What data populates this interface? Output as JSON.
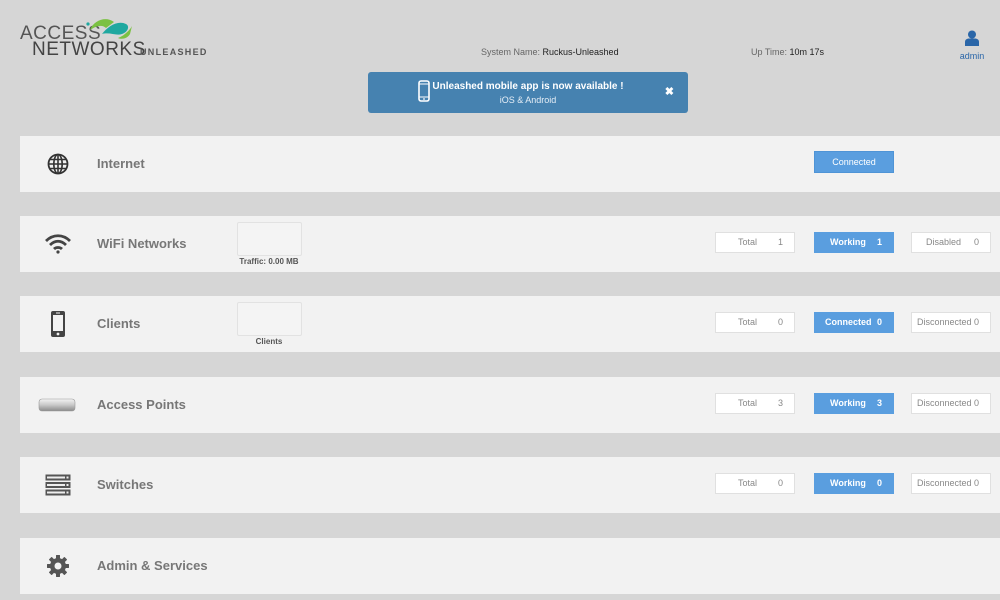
{
  "header": {
    "logo_line1": "ACCESS",
    "logo_line2": "NETWORKS",
    "logo_product": "UNLEASHED",
    "system_name_label": "System Name:",
    "system_name_value": "Ruckus-Unleashed",
    "uptime_label": "Up Time:",
    "uptime_value": "10m 17s",
    "user_label": "admin",
    "user_icon": "user-icon"
  },
  "banner": {
    "title": "Unleashed mobile app is now available !",
    "subtitle": "iOS & Android",
    "icon": "mobile-phone-icon",
    "close_icon": "close-icon",
    "color": "#4682b0"
  },
  "colors": {
    "accent": "#5a9edf",
    "row_bg": "#f2f2f2",
    "page_bg": "#d6d6d6"
  },
  "rows": {
    "internet": {
      "title": "Internet",
      "icon": "globe-icon",
      "status": "Connected"
    },
    "wifi": {
      "title": "WiFi Networks",
      "icon": "wifi-icon",
      "mini_label": "Traffic: 0.00 MB",
      "total_label": "Total",
      "total": "1",
      "working_label": "Working",
      "working": "1",
      "disabled_label": "Disabled",
      "disabled": "0"
    },
    "clients": {
      "title": "Clients",
      "icon": "smartphone-icon",
      "mini_label": "Clients",
      "total_label": "Total",
      "total": "0",
      "connected_label": "Connected",
      "connected": "0",
      "disconnected_label": "Disconnected",
      "disconnected": "0"
    },
    "access_points": {
      "title": "Access Points",
      "icon": "access-point-icon",
      "total_label": "Total",
      "total": "3",
      "working_label": "Working",
      "working": "3",
      "disconnected_label": "Disconnected",
      "disconnected": "0"
    },
    "switches": {
      "title": "Switches",
      "icon": "server-rack-icon",
      "total_label": "Total",
      "total": "0",
      "working_label": "Working",
      "working": "0",
      "disconnected_label": "Disconnected",
      "disconnected": "0"
    },
    "admin": {
      "title": "Admin & Services",
      "icon": "gear-icon"
    }
  }
}
